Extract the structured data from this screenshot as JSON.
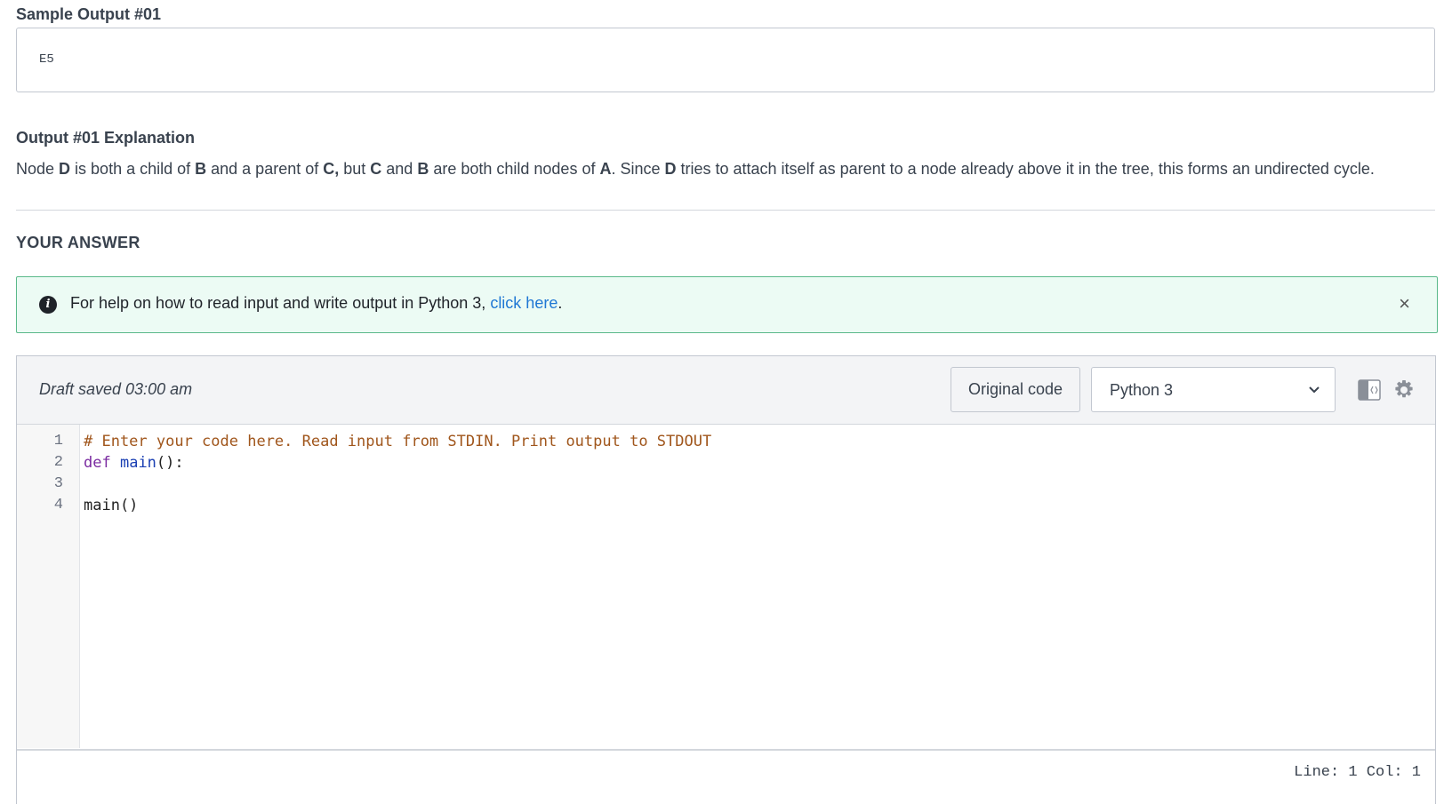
{
  "sample_output": {
    "title": "Sample Output #01",
    "value": "E5"
  },
  "explanation": {
    "title": "Output #01 Explanation",
    "segments": [
      {
        "t": "Node ",
        "b": false
      },
      {
        "t": "D",
        "b": true
      },
      {
        "t": " is both a child of ",
        "b": false
      },
      {
        "t": "B",
        "b": true
      },
      {
        "t": " and a parent of ",
        "b": false
      },
      {
        "t": "C,",
        "b": true
      },
      {
        "t": " but ",
        "b": false
      },
      {
        "t": "C",
        "b": true
      },
      {
        "t": " and ",
        "b": false
      },
      {
        "t": "B",
        "b": true
      },
      {
        "t": " are both child nodes of ",
        "b": false
      },
      {
        "t": "A",
        "b": true
      },
      {
        "t": ". Since ",
        "b": false
      },
      {
        "t": "D",
        "b": true
      },
      {
        "t": " tries to attach itself as parent to a node already above it in the tree, this forms an undirected cycle.",
        "b": false
      }
    ]
  },
  "answer": {
    "heading": "YOUR ANSWER"
  },
  "info_alert": {
    "text": "For help on how to read input and write output in Python 3, ",
    "link_text": "click here",
    "suffix": ".",
    "close_label": "×"
  },
  "editor": {
    "draft_status": "Draft saved 03:00 am",
    "original_code_label": "Original code",
    "language": "Python 3",
    "code_lines": [
      {
        "num": "1",
        "text": "# Enter your code here. Read input from STDIN. Print output to STDOUT"
      },
      {
        "num": "2",
        "kw": "def",
        "name": "main",
        "rest": "():"
      },
      {
        "num": "3",
        "text": ""
      },
      {
        "num": "4",
        "text": "main()"
      }
    ],
    "status": "Line: 1 Col: 1"
  },
  "icons": [
    "info-icon",
    "close-icon",
    "chevron-down-icon",
    "split-view-icon",
    "gear-icon"
  ],
  "colors": {
    "alert_bg": "#ecfbf4",
    "alert_border": "#5ab98a",
    "link": "#1f77d4",
    "comment": "#a0561c",
    "keyword": "#7a2aa0"
  }
}
